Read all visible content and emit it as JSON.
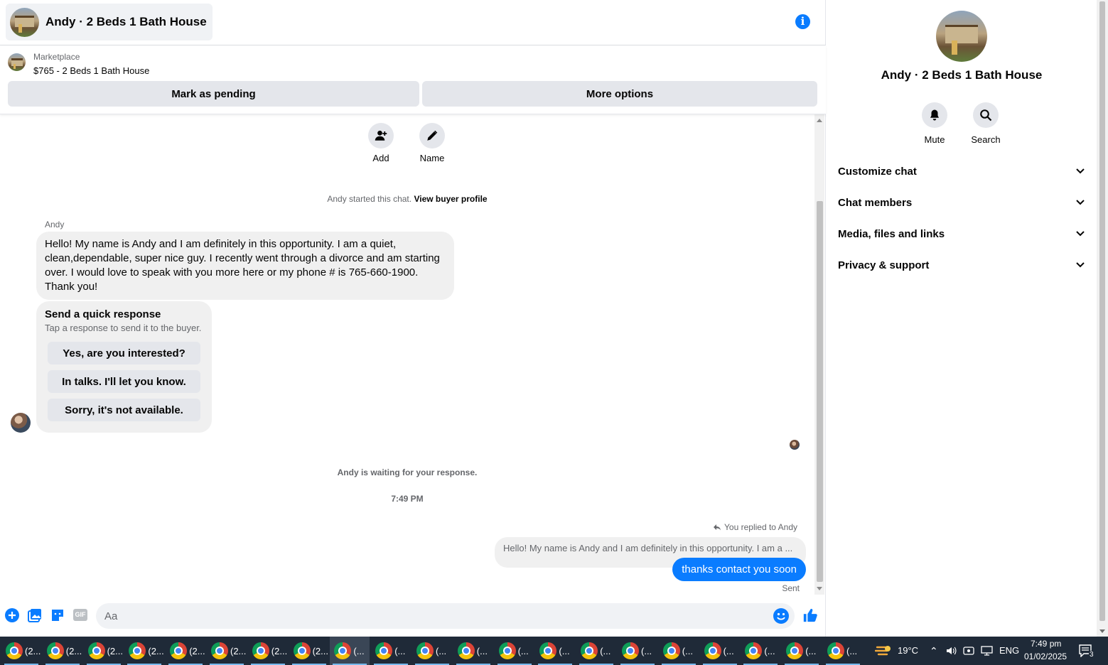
{
  "header": {
    "title": "Andy · 2 Beds 1 Bath House"
  },
  "listing": {
    "source": "Marketplace",
    "price_title": "$765 - 2 Beds 1 Bath House",
    "mark_pending": "Mark as pending",
    "more_options": "More options"
  },
  "actions": {
    "add": "Add",
    "name": "Name"
  },
  "conversation": {
    "started_text": "Andy started this chat.",
    "view_profile": "View buyer profile",
    "sender": "Andy",
    "message": "Hello! My name is Andy and  I am definitely in this opportunity. I am a quiet, clean,dependable,  super nice guy. I recently went through a divorce and am starting over. I would love to speak with you more here or my phone # is 765-660-1900. Thank you!",
    "quick_response": {
      "title": "Send a quick response",
      "subtitle": "Tap a response to send it to the buyer.",
      "options": [
        "Yes, are you interested?",
        "In talks. I'll let you know.",
        "Sorry, it's not available."
      ]
    },
    "waiting": "Andy is waiting for your response.",
    "time": "7:49 PM",
    "replied_to": "You replied to Andy",
    "quoted": "Hello! My name is Andy and  I am definitely in this opportunity. I am a ...",
    "reply": "thanks contact you soon",
    "status": "Sent"
  },
  "composer": {
    "placeholder": "Aa",
    "gif": "GIF"
  },
  "details": {
    "name": "Andy · 2 Beds 1 Bath House",
    "mute": "Mute",
    "search": "Search",
    "sections": [
      "Customize chat",
      "Chat members",
      "Media, files and links",
      "Privacy & support"
    ]
  },
  "taskbar": {
    "items": [
      "(2...",
      "(2...",
      "(2...",
      "(2...",
      "(2...",
      "(2...",
      "(2...",
      "(2...",
      "(...",
      "(...",
      "(...",
      "(...",
      "(...",
      "(...",
      "(...",
      "(...",
      "(...",
      "(...",
      "(...",
      "(...",
      "(..."
    ],
    "active_index": 8,
    "temperature": "19°C",
    "language": "ENG",
    "time": "7:49 pm",
    "date": "01/02/2025",
    "notifications": "3"
  },
  "colors": {
    "accent": "#0a7cff",
    "taskbar": "#1f2a38"
  }
}
